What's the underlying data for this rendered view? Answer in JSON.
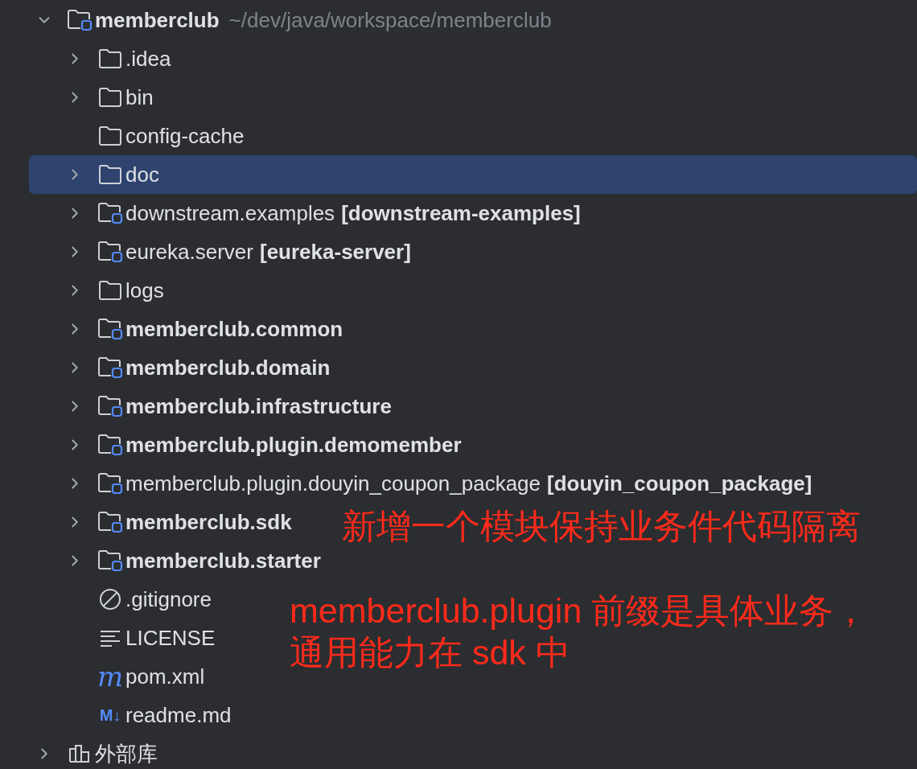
{
  "tree": {
    "name": "memberclub",
    "path": "~/dev/java/workspace/memberclub",
    "kind": "module",
    "bold": true,
    "expanded": true,
    "selected": false,
    "children": [
      {
        "name": ".idea",
        "kind": "folder",
        "bold": false,
        "expanded": false,
        "selected": false
      },
      {
        "name": "bin",
        "kind": "folder",
        "bold": false,
        "expanded": false,
        "selected": false
      },
      {
        "name": "config-cache",
        "kind": "folder",
        "bold": false,
        "selected": false
      },
      {
        "name": "doc",
        "kind": "folder",
        "bold": false,
        "expanded": false,
        "selected": true
      },
      {
        "name": "downstream.examples",
        "tag": "[downstream-examples]",
        "kind": "module",
        "bold": false,
        "expanded": false,
        "selected": false
      },
      {
        "name": "eureka.server",
        "tag": "[eureka-server]",
        "kind": "module",
        "bold": false,
        "expanded": false,
        "selected": false
      },
      {
        "name": "logs",
        "kind": "folder",
        "bold": false,
        "expanded": false,
        "selected": false
      },
      {
        "name": "memberclub.common",
        "kind": "module",
        "bold": true,
        "expanded": false,
        "selected": false
      },
      {
        "name": "memberclub.domain",
        "kind": "module",
        "bold": true,
        "expanded": false,
        "selected": false
      },
      {
        "name": "memberclub.infrastructure",
        "kind": "module",
        "bold": true,
        "expanded": false,
        "selected": false
      },
      {
        "name": "memberclub.plugin.demomember",
        "kind": "module",
        "bold": true,
        "expanded": false,
        "selected": false
      },
      {
        "name": "memberclub.plugin.douyin_coupon_package",
        "tag": "[douyin_coupon_package]",
        "kind": "module",
        "bold": false,
        "expanded": false,
        "selected": false
      },
      {
        "name": "memberclub.sdk",
        "kind": "module",
        "bold": true,
        "expanded": false,
        "selected": false
      },
      {
        "name": "memberclub.starter",
        "kind": "module",
        "bold": true,
        "expanded": false,
        "selected": false
      },
      {
        "name": ".gitignore",
        "kind": "ignore",
        "bold": false,
        "selected": false
      },
      {
        "name": "LICENSE",
        "kind": "text",
        "bold": false,
        "selected": false
      },
      {
        "name": "pom.xml",
        "kind": "maven",
        "glyph": "m",
        "bold": false,
        "selected": false
      },
      {
        "name": "readme.md",
        "kind": "markdown",
        "glyph": "M↓",
        "bold": false,
        "selected": false
      }
    ]
  },
  "libraries": {
    "name": "外部库",
    "kind": "library",
    "bold": false,
    "expanded": false,
    "selected": false
  },
  "annotations": [
    {
      "lines": [
        "新增一个模块保持业务件代码隔离"
      ],
      "color": "#ff2a1a"
    },
    {
      "lines": [
        "memberclub.plugin 前缀是具体业务，",
        "通用能力在 sdk 中"
      ],
      "color": "#ff2a1a"
    }
  ]
}
